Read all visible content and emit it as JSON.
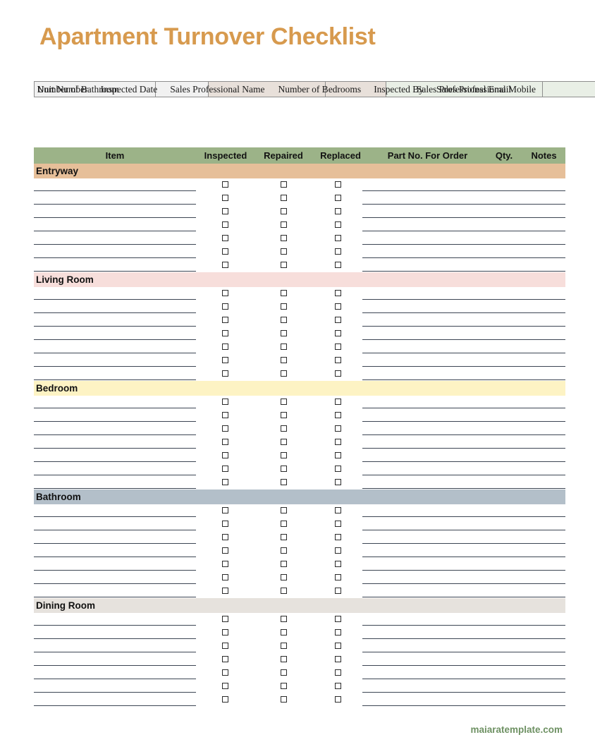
{
  "document": {
    "title": "Apartment Turnover Checklist",
    "title_color": "#d79a4e",
    "footer": "maiaratemplate.com",
    "footer_color": "#6e9163"
  },
  "info_table": {
    "rows": [
      {
        "label1": "Unit Number",
        "value1": "",
        "label2": "Inspected Date",
        "value2": "",
        "label3": "Sales Professional Name",
        "value3": ""
      },
      {
        "label1": "Number of Bedrooms",
        "value1": "",
        "label2": "Inspected By",
        "value2": "",
        "label3": "Sales Professional Mobile",
        "value3": ""
      },
      {
        "label1": "Number of Bathroom",
        "value1": "",
        "label2": "",
        "value2": "",
        "label3": "Sales Professional Email",
        "value3": ""
      }
    ],
    "group_colors": {
      "group1": "#f1f1f1",
      "group2": "#e8e0da",
      "group3": "#e9efe6"
    }
  },
  "checklist": {
    "header_color": "#9cb388",
    "columns": {
      "item": "Item",
      "inspected": "Inspected",
      "repaired": "Repaired",
      "replaced": "Replaced",
      "part_no": "Part No. For Order",
      "qty": "Qty.",
      "notes": "Notes"
    },
    "sections": [
      {
        "name": "Entryway",
        "color": "#e6bf99",
        "rows": 7,
        "checkbox_rows": 7
      },
      {
        "name": "Living Room",
        "color": "#f7dedb",
        "rows": 7,
        "checkbox_rows": 7
      },
      {
        "name": "Bedroom",
        "color": "#fdf3c4",
        "rows": 7,
        "checkbox_rows": 7
      },
      {
        "name": "Bathroom",
        "color": "#b3bfc9",
        "rows": 7,
        "checkbox_rows": 7
      },
      {
        "name": "Dining Room",
        "color": "#e6e2dd",
        "rows": 7,
        "checkbox_rows": 7
      }
    ]
  }
}
